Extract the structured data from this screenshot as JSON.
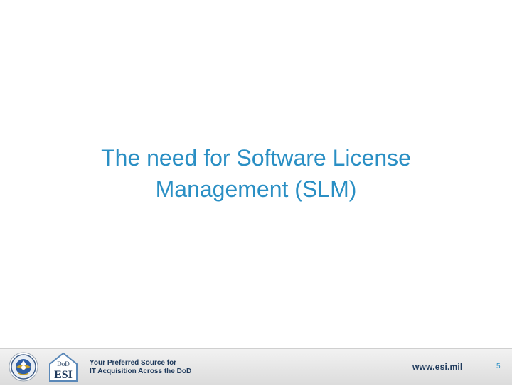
{
  "slide": {
    "title_line1": "The need for Software License",
    "title_line2": "Management (SLM)",
    "title_color": "#2a8fc4"
  },
  "footer": {
    "logo_text": "DoD ESI",
    "logo_top": "DoD",
    "logo_main": "ESI",
    "tagline_line1": "Your Preferred Source for",
    "tagline_line2": "IT Acquisition Across the DoD",
    "website": "www.esi.mil",
    "page_number": "5",
    "text_color": "#1f3a5c"
  },
  "icons": {
    "seal": "dod-seal-icon",
    "logo": "esi-logo-icon"
  }
}
